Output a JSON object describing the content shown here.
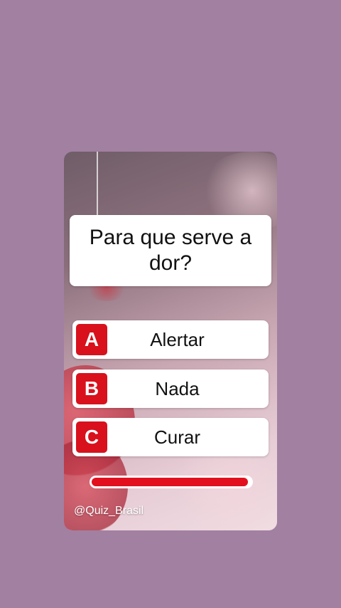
{
  "quiz": {
    "question": "Para que serve a dor?",
    "answers": [
      {
        "letter": "A",
        "label": "Alertar"
      },
      {
        "letter": "B",
        "label": "Nada"
      },
      {
        "letter": "C",
        "label": "Curar"
      }
    ],
    "timer_progress": 0.98,
    "watermark": "@Quiz_Brasil"
  },
  "colors": {
    "page_background": "#a280a1",
    "accent_red": "#d8111d",
    "timer_red": "#e2101f",
    "box_white": "#ffffff"
  }
}
